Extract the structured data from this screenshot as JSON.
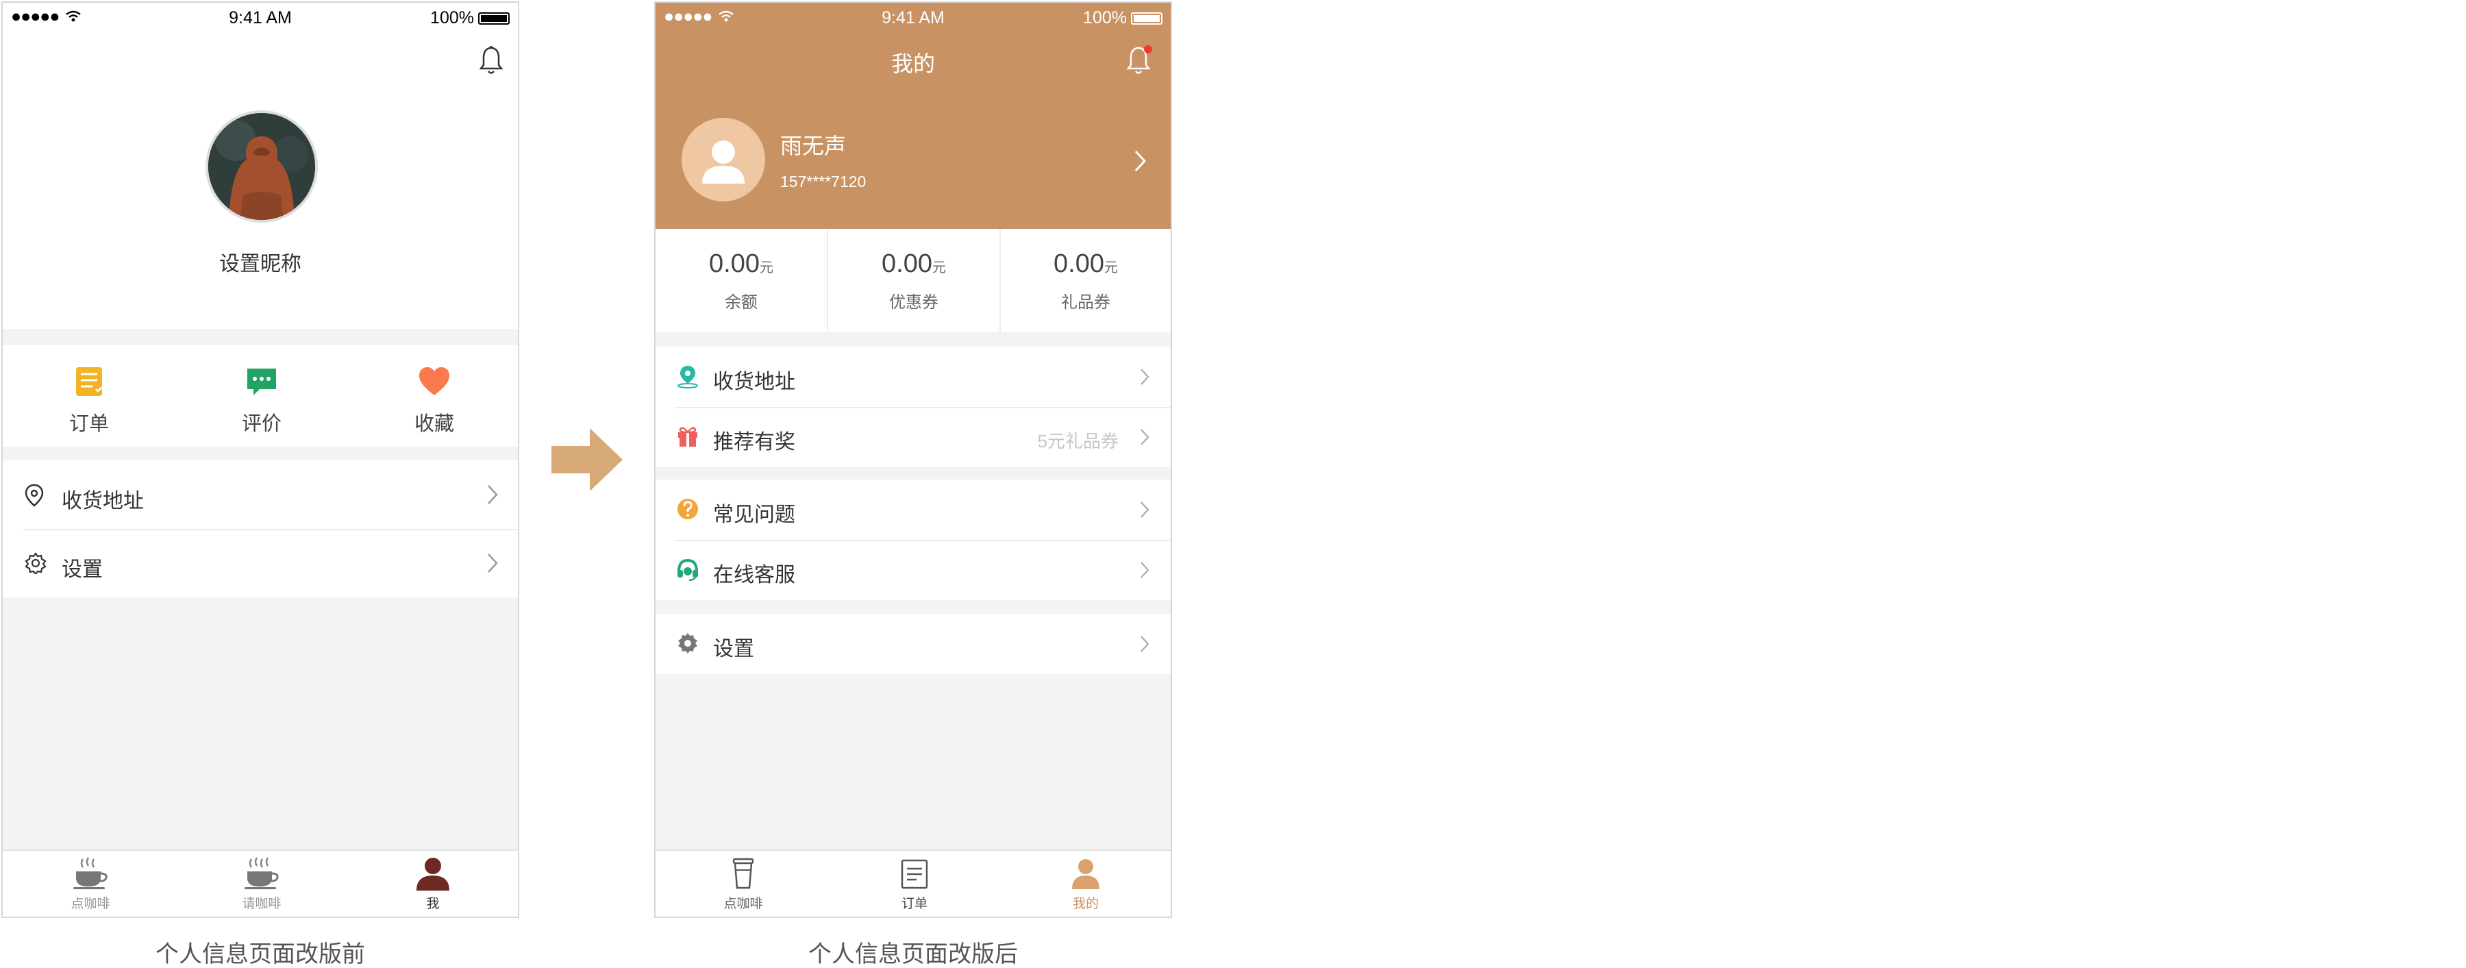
{
  "status_bar": {
    "signal": "●●●●●",
    "time": "9:41 AM",
    "battery": "100%"
  },
  "before": {
    "nickname": "设置昵称",
    "quick_actions": [
      {
        "label": "订单",
        "icon": "order-icon",
        "color": "#f4b324"
      },
      {
        "label": "评价",
        "icon": "comment-icon",
        "color": "#22a366"
      },
      {
        "label": "收藏",
        "icon": "heart-icon",
        "color": "#fa7a4d"
      }
    ],
    "menu": [
      {
        "label": "收货地址",
        "icon": "location-pin-icon"
      },
      {
        "label": "设置",
        "icon": "gear-icon"
      }
    ],
    "tabs": [
      {
        "label": "点咖啡",
        "icon": "coffee-cup-icon"
      },
      {
        "label": "请咖啡",
        "icon": "coffee-gift-icon"
      },
      {
        "label": "我",
        "icon": "person-icon"
      }
    ],
    "caption": "个人信息页面改版前"
  },
  "after": {
    "title": "我的",
    "header_color": "#c89263",
    "user": {
      "name": "雨无声",
      "phone": "157****7120"
    },
    "stats": [
      {
        "value": "0.00",
        "unit": "元",
        "label": "余额"
      },
      {
        "value": "0.00",
        "unit": "元",
        "label": "优惠券"
      },
      {
        "value": "0.00",
        "unit": "元",
        "label": "礼品券"
      }
    ],
    "menu_group1": [
      {
        "label": "收货地址",
        "icon": "location-pin-icon",
        "hint": ""
      },
      {
        "label": "推荐有奖",
        "icon": "gift-icon",
        "hint": "5元礼品券"
      }
    ],
    "menu_group2": [
      {
        "label": "常见问题",
        "icon": "question-icon",
        "hint": ""
      },
      {
        "label": "在线客服",
        "icon": "headset-icon",
        "hint": ""
      }
    ],
    "menu_group3": [
      {
        "label": "设置",
        "icon": "gear-icon",
        "hint": ""
      }
    ],
    "tabs": [
      {
        "label": "点咖啡",
        "icon": "coffee-cup-icon"
      },
      {
        "label": "订单",
        "icon": "order-icon"
      },
      {
        "label": "我的",
        "icon": "person-icon"
      }
    ],
    "active_tab_color": "#c89263",
    "caption": "个人信息页面改版后"
  }
}
